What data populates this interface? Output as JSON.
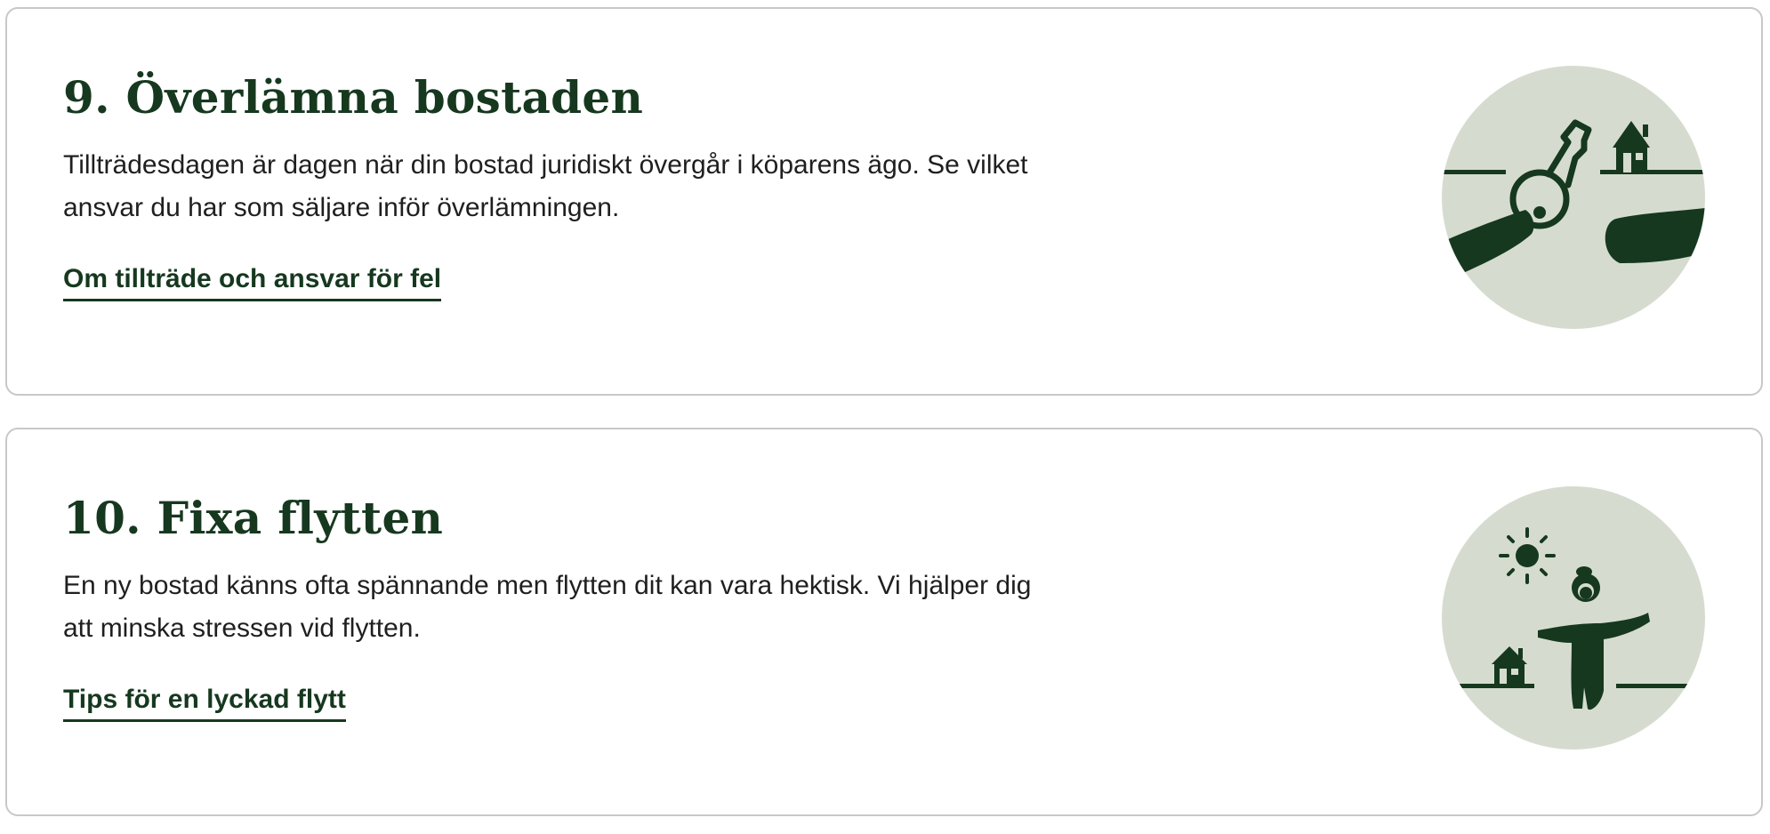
{
  "cards": [
    {
      "title": "9. Överlämna bostaden",
      "text": "Tillträdesdagen är dagen när din bostad juridiskt övergår i köparens ägo. Se vilket ansvar du har som säljare inför överlämningen.",
      "link": "Om tillträde och ansvar för fel",
      "illustration_icon": "key-handover-icon"
    },
    {
      "title": "10. Fixa flytten",
      "text": "En ny bostad känns ofta spännande men flytten dit kan vara hektisk. Vi hjälper dig att minska stressen vid flytten.",
      "link": "Tips för en lyckad flytt",
      "illustration_icon": "moving-person-icon"
    }
  ],
  "colors": {
    "brand_green": "#16381f",
    "illustration_bg": "#d5dccf",
    "card_border": "#c8c8c8",
    "text": "#1f1f1f"
  }
}
